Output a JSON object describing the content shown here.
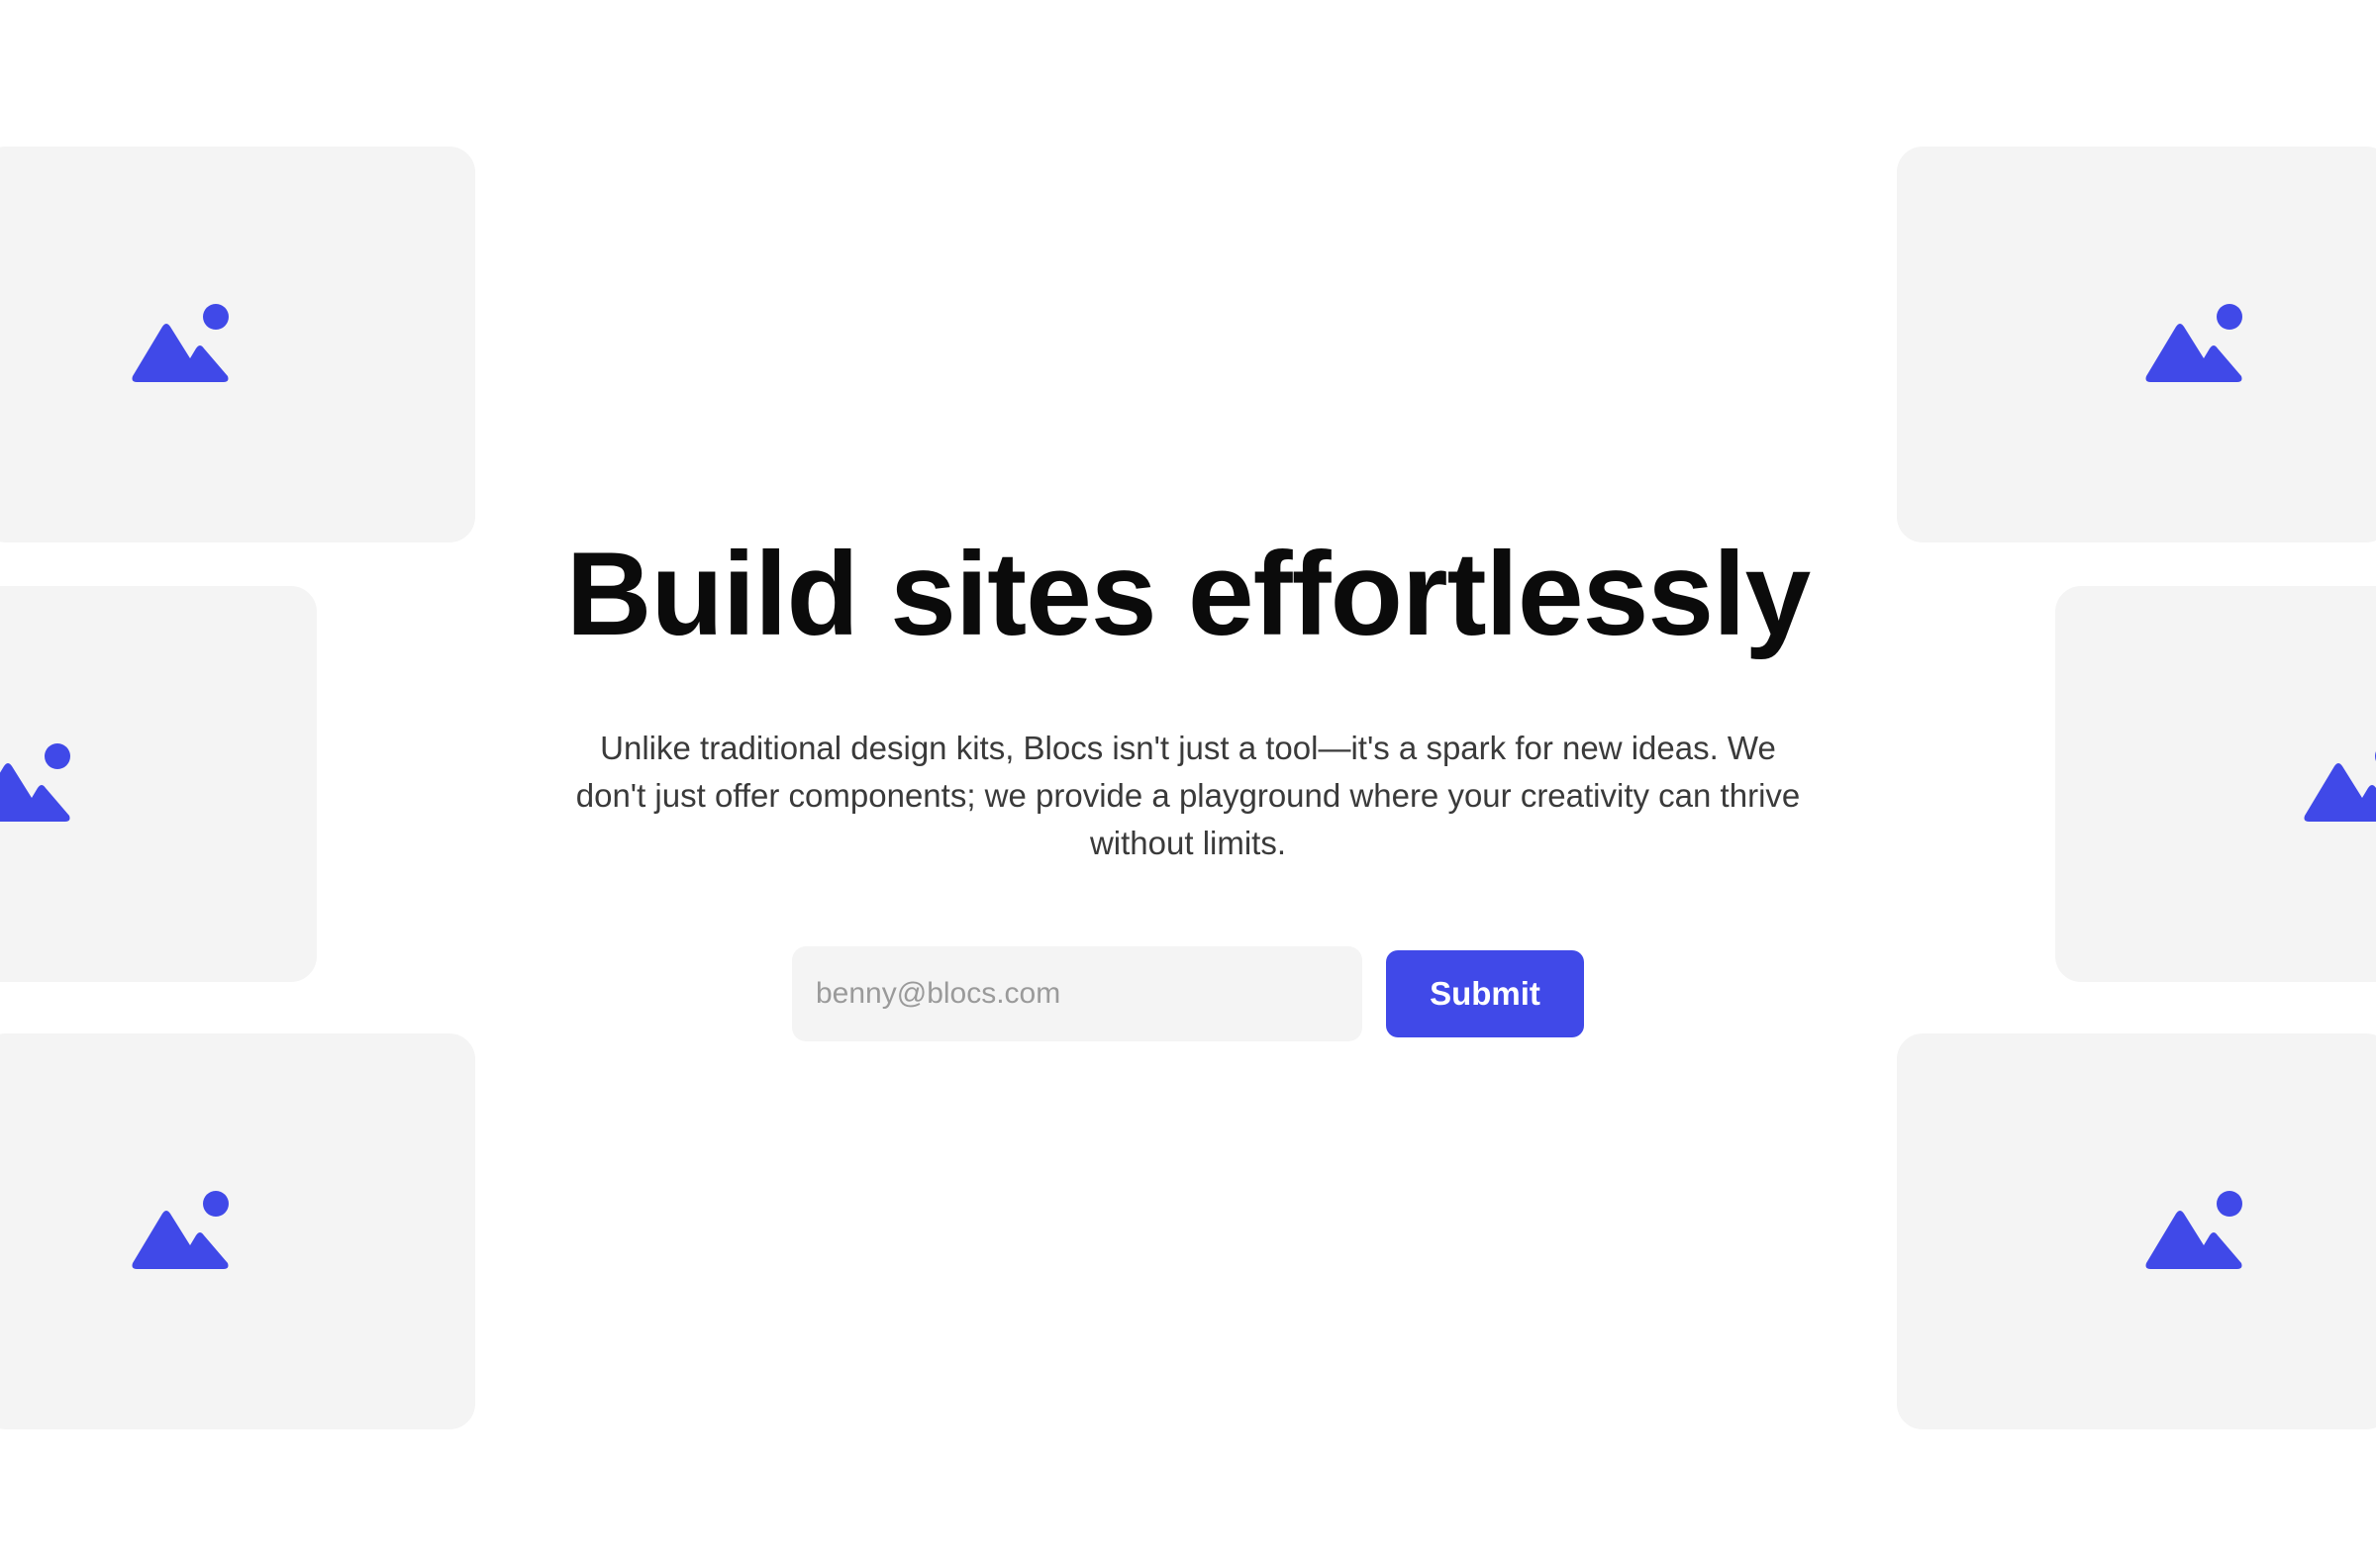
{
  "hero": {
    "title": "Build sites effortlessly",
    "subtitle": "Unlike traditional design kits, Blocs isn't just a tool—it's a spark for new ideas. We don't just offer components; we provide a playground where your creativity can thrive without limits."
  },
  "signup": {
    "email_placeholder": "benny@blocs.com",
    "submit_label": "Submit"
  },
  "theme": {
    "accent": "#4049e8",
    "tile_background": "#f4f4f4",
    "page_background": "#ffffff"
  },
  "placeholder_images": [
    {
      "icon": "image-placeholder-icon"
    },
    {
      "icon": "image-placeholder-icon"
    },
    {
      "icon": "image-placeholder-icon"
    },
    {
      "icon": "image-placeholder-icon"
    },
    {
      "icon": "image-placeholder-icon"
    },
    {
      "icon": "image-placeholder-icon"
    }
  ]
}
